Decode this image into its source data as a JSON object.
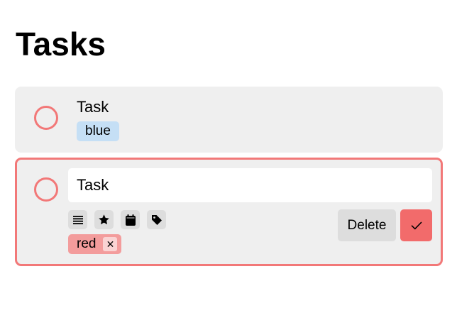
{
  "page": {
    "title": "Tasks"
  },
  "tasks": [
    {
      "title": "Task",
      "tags": [
        {
          "label": "blue",
          "color": "#c5dff5"
        }
      ]
    }
  ],
  "editing_task": {
    "title_value": "Task",
    "toolbar_icons": [
      "notes-icon",
      "star-icon",
      "calendar-icon",
      "tag-icon"
    ],
    "tags": [
      {
        "label": "red",
        "color": "#f39c9c",
        "remove_symbol": "✕"
      }
    ],
    "delete_label": "Delete",
    "done_icon": "check-icon"
  },
  "colors": {
    "accent": "#f27878",
    "done_button": "#f26b6b",
    "card_background": "#efefef",
    "button_background": "#dddddd"
  }
}
